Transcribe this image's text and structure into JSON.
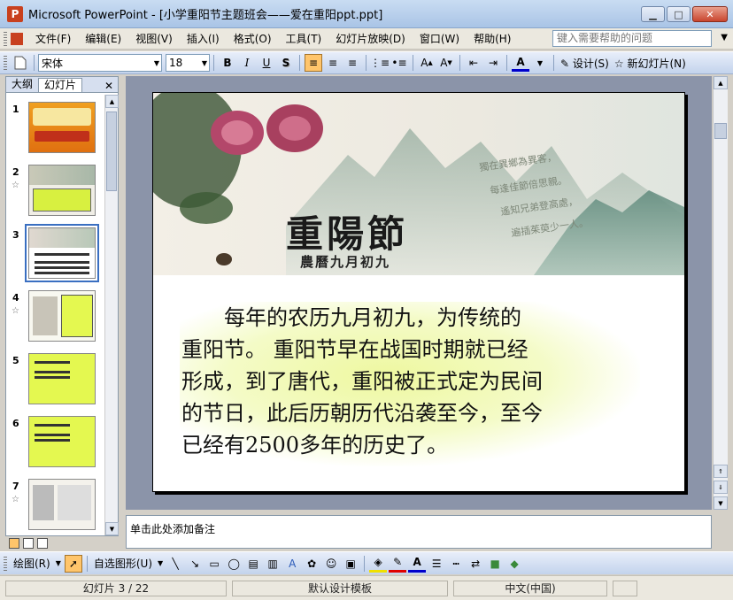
{
  "window": {
    "title": "Microsoft PowerPoint - [小学重阳节主题班会——爱在重阳ppt.ppt]",
    "app_icon_letter": "P",
    "controls": [
      "▁",
      "□",
      "✕"
    ]
  },
  "menubar": {
    "items": [
      "文件(F)",
      "编辑(E)",
      "视图(V)",
      "插入(I)",
      "格式(O)",
      "工具(T)",
      "幻灯片放映(D)",
      "窗口(W)",
      "帮助(H)"
    ],
    "help_placeholder": "键入需要帮助的问题"
  },
  "toolbar": {
    "font_name": "宋体",
    "font_size": "18",
    "bold": "B",
    "italic": "I",
    "underline": "U",
    "shadow": "S",
    "align_left": "≡",
    "align_center": "≡",
    "align_right": "≡",
    "font_color": "A",
    "design_label": "设计(S)",
    "new_slide_label": "新幻灯片(N)"
  },
  "left_pane": {
    "tab_outline": "大纲",
    "tab_slides": "幻灯片",
    "close": "✕",
    "thumbnails": [
      {
        "num": "1",
        "star": "",
        "selected": false
      },
      {
        "num": "2",
        "star": "☆",
        "selected": false
      },
      {
        "num": "3",
        "star": "",
        "selected": true
      },
      {
        "num": "4",
        "star": "☆",
        "selected": false
      },
      {
        "num": "5",
        "star": "",
        "selected": false
      },
      {
        "num": "6",
        "star": "",
        "selected": false
      },
      {
        "num": "7",
        "star": "☆",
        "selected": false
      }
    ]
  },
  "slide": {
    "title": "重陽節",
    "subtitle": "農曆九月初九",
    "poem_lines": [
      "獨在異鄉為異客，",
      "每逢佳節倍思親。",
      "遙知兄弟登高處，",
      "遍插茱萸少一人。"
    ],
    "body_lines": [
      "　　每年的农历九月初九，为传统的",
      "重阳节。 重阳节早在战国时期就已经",
      "形成，到了唐代，重阳被正式定为民间",
      "的节日，此后历朝历代沿袭至今，至今",
      "已经有2500多年的历史了。"
    ]
  },
  "notes": {
    "placeholder": "单击此处添加备注"
  },
  "drawbar": {
    "draw_label": "绘图(R)",
    "autoshape_label": "自选图形(U)"
  },
  "status": {
    "slide_info": "幻灯片 3 / 22",
    "template": "默认设计模板",
    "language": "中文(中国)"
  }
}
